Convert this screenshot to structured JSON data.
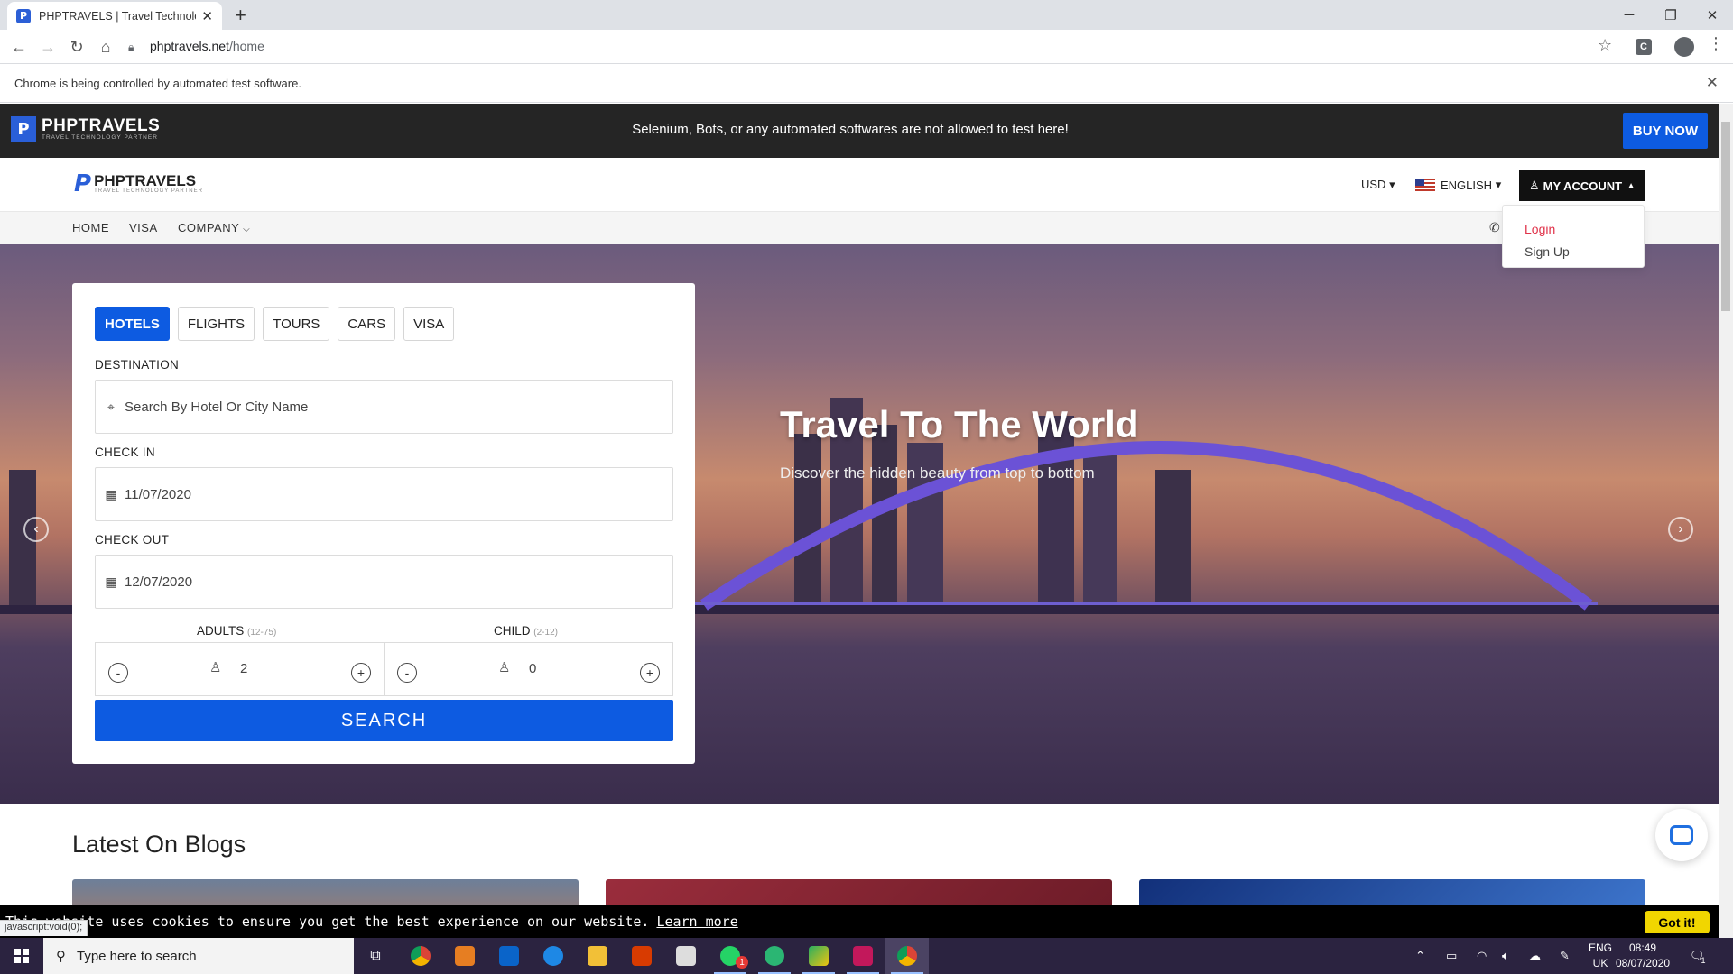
{
  "browser": {
    "tab_title": "PHPTRAVELS | Travel Technology",
    "tab_favicon": "P",
    "url_host": "phptravels.net",
    "url_path": "/home",
    "automation_notice": "Chrome is being controlled by automated test software.",
    "status_url": "javascript:void(0);",
    "extension_label": "C"
  },
  "topbar": {
    "brand": "PHPTRAVELS",
    "brand_sub": "TRAVEL TECHNOLOGY PARTNER",
    "notice": "Selenium, Bots, or any automated softwares are not allowed to test here!",
    "buy_now": "BUY NOW"
  },
  "header": {
    "brand": "PHPTRAVELS",
    "brand_sub": "TRAVEL TECHNOLOGY PARTNER",
    "currency": "USD",
    "language": "ENGLISH",
    "account": "MY ACCOUNT"
  },
  "account_menu": {
    "items": [
      "Login",
      "Sign Up"
    ],
    "active_color": "#e0334a"
  },
  "nav": {
    "items": [
      "HOME",
      "VISA",
      "COMPANY"
    ]
  },
  "hero": {
    "title": "Travel To The World",
    "subtitle": "Discover the hidden beauty from top to bottom"
  },
  "search": {
    "tabs": [
      "HOTELS",
      "FLIGHTS",
      "TOURS",
      "CARS",
      "VISA"
    ],
    "active_tab": "HOTELS",
    "destination_label": "DESTINATION",
    "destination_placeholder": "Search By Hotel Or City Name",
    "checkin_label": "CHECK IN",
    "checkin_value": "11/07/2020",
    "checkout_label": "CHECK OUT",
    "checkout_value": "12/07/2020",
    "adults_label": "ADULTS",
    "adults_range": "(12-75)",
    "adults_value": "2",
    "child_label": "CHILD",
    "child_range": "(2-12)",
    "child_value": "0",
    "minus": "-",
    "plus": "+",
    "search_button": "SEARCH",
    "accent_color": "#0d5be1"
  },
  "blogs": {
    "title": "Latest On Blogs"
  },
  "cookie": {
    "message": "This website uses cookies to ensure you get the best experience on our website.",
    "learn_more": "Learn more",
    "got_it": "Got it!"
  },
  "taskbar": {
    "search_placeholder": "Type here to search",
    "lang_top": "ENG",
    "lang_bottom": "UK",
    "time": "08:49",
    "date": "08/07/2020",
    "notification_count": "1",
    "whatsapp_badge": "1"
  }
}
